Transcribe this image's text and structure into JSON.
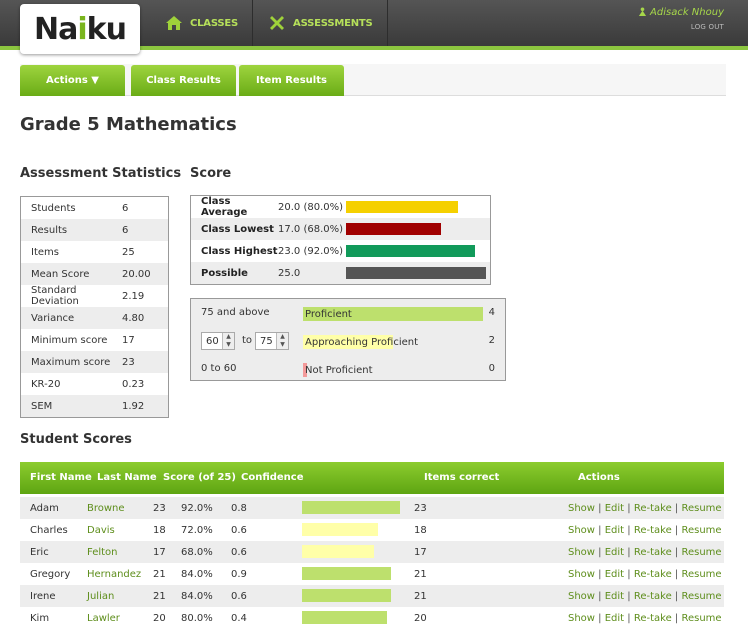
{
  "header": {
    "logo_text_1": "Na",
    "logo_text_2": "i",
    "logo_text_3": "ku",
    "nav": [
      {
        "label": "CLASSES",
        "icon": "home-icon"
      },
      {
        "label": "ASSESSMENTS",
        "icon": "tools-icon"
      }
    ],
    "user_name": "Adisack Nhouy",
    "logout": "LOG OUT"
  },
  "tabs": [
    {
      "label": "Actions ▼"
    },
    {
      "label": "Class Results"
    },
    {
      "label": "Item Results"
    }
  ],
  "page_title": "Grade 5 Mathematics",
  "stats": {
    "heading": "Assessment Statistics",
    "rows": [
      {
        "k": "Students",
        "v": "6"
      },
      {
        "k": "Results",
        "v": "6"
      },
      {
        "k": "Items",
        "v": "25"
      },
      {
        "k": "Mean Score",
        "v": "20.00"
      },
      {
        "k": "Standard Deviation",
        "v": "2.19"
      },
      {
        "k": "Variance",
        "v": "4.80"
      },
      {
        "k": "Minimum score",
        "v": "17"
      },
      {
        "k": "Maximum score",
        "v": "23"
      },
      {
        "k": "KR-20",
        "v": "0.23"
      },
      {
        "k": "SEM",
        "v": "1.92"
      }
    ]
  },
  "score": {
    "heading": "Score",
    "max": 25,
    "rows": [
      {
        "k": "Class Average",
        "v": "20.0 (80.0%)",
        "value": 20.0,
        "color": "#f5d000"
      },
      {
        "k": "Class Lowest",
        "v": "17.0 (68.0%)",
        "value": 17.0,
        "color": "#a00000"
      },
      {
        "k": "Class Highest",
        "v": "23.0 (92.0%)",
        "value": 23.0,
        "color": "#119a5a"
      },
      {
        "k": "Possible",
        "v": "25.0",
        "value": 25.0,
        "color": "#555555"
      }
    ]
  },
  "proficiency": {
    "total": 6,
    "above_label": "75 and above",
    "low_value": "60",
    "to_label": "to",
    "high_value": "75",
    "below_label": "0 to 60",
    "levels": [
      {
        "name": "Proficient",
        "count": "4",
        "n": 4,
        "color": "#bde06d"
      },
      {
        "name": "Approaching Proficient",
        "count": "2",
        "n": 2,
        "color": "#ffffa8"
      },
      {
        "name": "Not Proficient",
        "count": "0",
        "n": 0,
        "color": "#f39a9a"
      }
    ]
  },
  "students": {
    "heading": "Student Scores",
    "columns": {
      "first": "First Name",
      "last": "Last Name",
      "score": "Score (of 25)",
      "confidence": "Confidence",
      "items": "Items correct",
      "actions": "Actions"
    },
    "action_labels": [
      "Show",
      "Edit",
      "Re-take",
      "Resume"
    ],
    "bar_max": 25,
    "rows": [
      {
        "first": "Adam",
        "last": "Browne",
        "score": "23",
        "pct": "92.0%",
        "conf": "0.8",
        "items": "23",
        "n": 23,
        "color": "#bde06d"
      },
      {
        "first": "Charles",
        "last": "Davis",
        "score": "18",
        "pct": "72.0%",
        "conf": "0.6",
        "items": "18",
        "n": 18,
        "color": "#ffffa8"
      },
      {
        "first": "Eric",
        "last": "Felton",
        "score": "17",
        "pct": "68.0%",
        "conf": "0.6",
        "items": "17",
        "n": 17,
        "color": "#ffffa8"
      },
      {
        "first": "Gregory",
        "last": "Hernandez",
        "score": "21",
        "pct": "84.0%",
        "conf": "0.9",
        "items": "21",
        "n": 21,
        "color": "#bde06d"
      },
      {
        "first": "Irene",
        "last": "Julian",
        "score": "21",
        "pct": "84.0%",
        "conf": "0.6",
        "items": "21",
        "n": 21,
        "color": "#bde06d"
      },
      {
        "first": "Kim",
        "last": "Lawler",
        "score": "20",
        "pct": "80.0%",
        "conf": "0.4",
        "items": "20",
        "n": 20,
        "color": "#bde06d"
      }
    ]
  }
}
